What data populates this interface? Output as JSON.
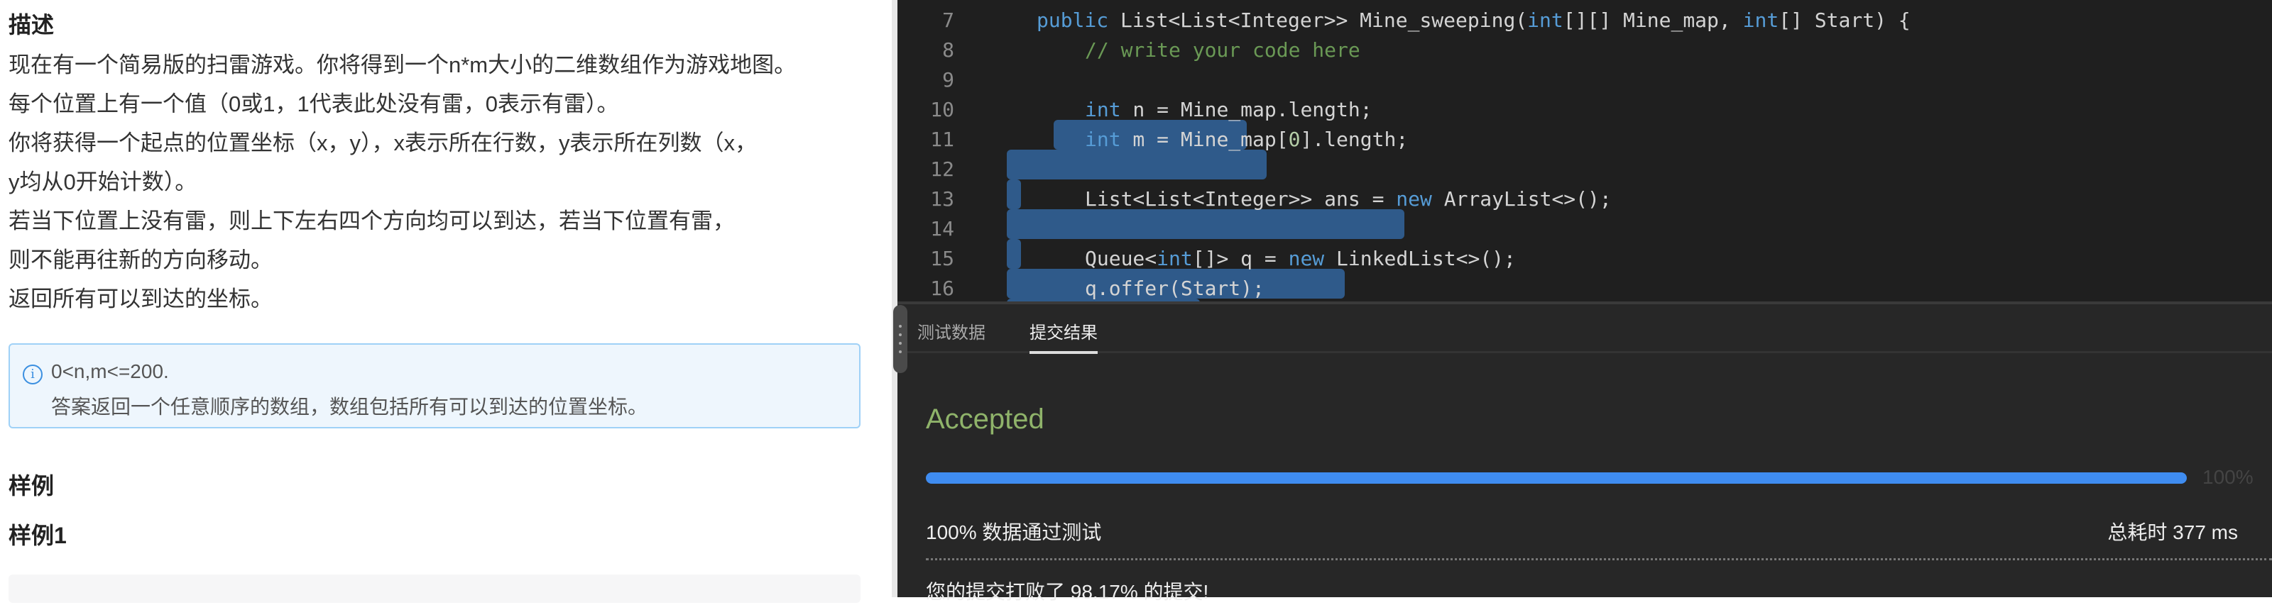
{
  "description": {
    "heading": "描述",
    "lines": [
      "现在有一个简易版的扫雷游戏。你将得到一个n*m大小的二维数组作为游戏地图。",
      "每个位置上有一个值（0或1，1代表此处没有雷，0表示有雷）。",
      "你将获得一个起点的位置坐标（x，y），x表示所在行数，y表示所在列数（x，",
      "y均从0开始计数）。",
      "若当下位置上没有雷，则上下左右四个方向均可以到达，若当下位置有雷，",
      "则不能再往新的方向移动。",
      "返回所有可以到达的坐标。"
    ],
    "note": [
      "0<n,m<=200.",
      "答案返回一个任意顺序的数组，数组包括所有可以到达的位置坐标。"
    ],
    "note_icon": "info-icon",
    "samples_heading": "样例",
    "sample1_heading": "样例1"
  },
  "editor": {
    "line_numbers": [
      "7",
      "8",
      "9",
      "10",
      "11",
      "12",
      "13",
      "14",
      "15",
      "16"
    ]
  },
  "result": {
    "tabs": [
      "测试数据",
      "提交结果"
    ],
    "active_tab": "提交结果",
    "status": "Accepted",
    "status_color": "#8fb36a",
    "progress_percent": 100,
    "progress_label": "100%",
    "passed": "100% 数据通过测试",
    "time": "总耗时 377 ms",
    "beat": "您的提交打败了 98.17% 的提交!"
  }
}
